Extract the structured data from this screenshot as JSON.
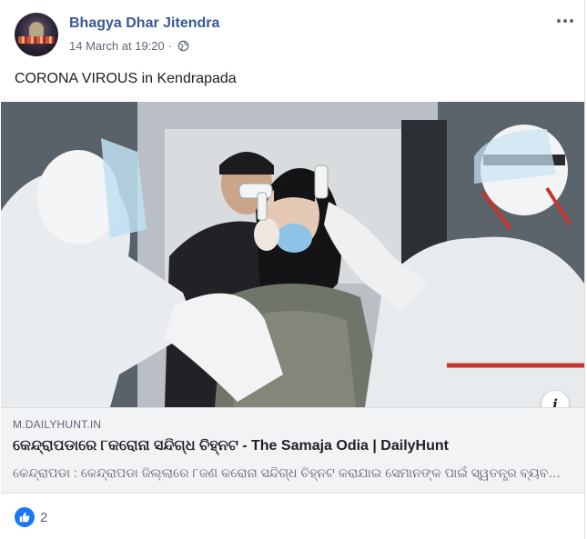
{
  "post": {
    "author": "Bhagya Dhar Jitendra",
    "timestamp": "14 March at 19:20",
    "separator": "·",
    "privacy_icon": "globe-icon",
    "more_icon": "more-options-icon",
    "text": "CORONA VIROUS in Kendrapada"
  },
  "link_preview": {
    "domain": "M.DAILYHUNT.IN",
    "title": "କେନ୍ଦ୍ରାପଡାରେ ୮କରୋନା ସନ୍ଦିଗ୍ଧ ଚିହ୍ନଟ - The Samaja Odia | DailyHunt",
    "description": "କେନ୍ଦ୍ରାପଡା : କେନ୍ଦ୍ରାପଡା ଜିଲ୍ଲାରେ ୮ଜଣ କରୋନା ସନ୍ଦିଗ୍ଧ ଚିହ୍ନଟ କରାଯାଇ ସେମାନଙ୍କ ପାଇଁ ସ୍ୱତନ୍ତ୍ର ବ୍ୟବସ୍ଥା କରାଯାଇଛି",
    "info_label": "i"
  },
  "reactions": {
    "icon": "like-icon",
    "count": "2"
  },
  "colors": {
    "author": "#385898",
    "like": "#1877f2",
    "link_bg": "#f2f3f5",
    "muted": "#606770"
  }
}
